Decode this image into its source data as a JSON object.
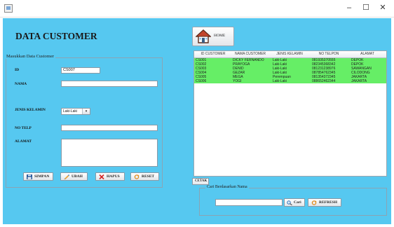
{
  "window": {
    "minimize_glyph": "–",
    "maximize_glyph": "☐",
    "close_glyph": "✕"
  },
  "page_title": "DATA CUSTOMER",
  "home_button": {
    "label": "HOME",
    "icon": "home-icon"
  },
  "form": {
    "legend": "Masukkan Data Customer",
    "id_label": "ID",
    "id_value": "CS007",
    "nama_label": "NAMA",
    "nama_value": "",
    "jenis_label": "JENIS KELAMIN",
    "jenis_value": "Laki-Laki",
    "jenis_arrow": "▾",
    "telp_label": "NO TELP",
    "telp_value": "",
    "alamat_label": "ALAMAT",
    "alamat_value": ""
  },
  "buttons": {
    "simpan": "SIMPAN",
    "ubah": "UBAH",
    "hapus": "HAPUS",
    "reset": "RESET"
  },
  "table": {
    "columns": [
      "ID CUSTOMER",
      "NAMA CUSTOMER",
      "JENIS KELAMIN",
      "NO TELPON",
      "ALAMAT"
    ],
    "rows": [
      [
        "CS001",
        "DICKY FERNANDO",
        "Laki-Laki",
        "081935370555",
        "DEPOK"
      ],
      [
        "CS002",
        "PRAYOGA",
        "Laki-Laki",
        "082345368342",
        "DEPOK"
      ],
      [
        "CS003",
        "DENID",
        "Laki-Laki",
        "081231238976",
        "SAWANGAN"
      ],
      [
        "CS004",
        "GEZAR",
        "Laki-Laki",
        "087854762345",
        "CILODONG"
      ],
      [
        "CS005",
        "MEGA",
        "Perempuan",
        "081354372345",
        "JAKARTA"
      ],
      [
        "CS006",
        "YOGI",
        "Laki-Laki",
        "088652462344",
        "JAKARTA"
      ]
    ]
  },
  "cetak_label": "CETAK",
  "search": {
    "legend": "Cari Berdasarkan Nama",
    "value": "",
    "cari_label": "Cari",
    "refresh_label": "REFRESH"
  },
  "colors": {
    "background": "#56c8f0",
    "row_highlight": "#66ee66"
  }
}
